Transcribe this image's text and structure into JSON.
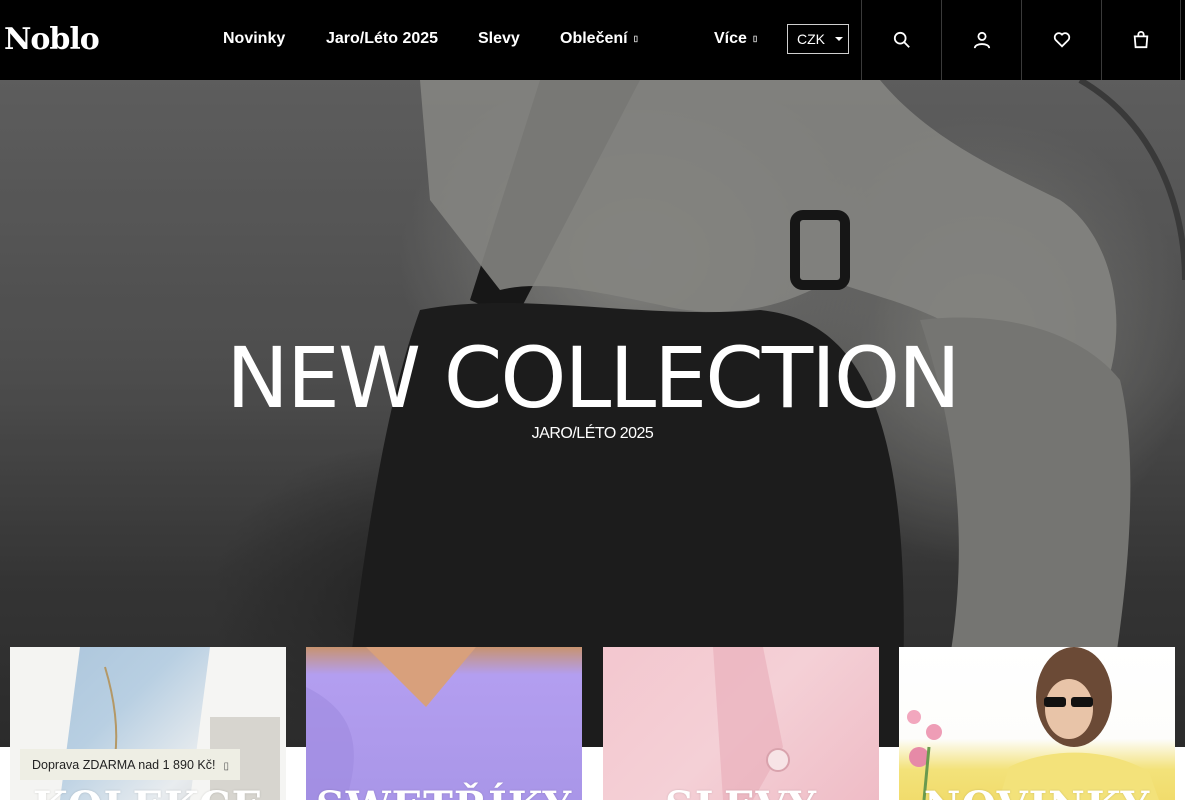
{
  "brand": {
    "logo_text": "Noblo"
  },
  "nav": {
    "items": [
      {
        "label": "Novinky"
      },
      {
        "label": "Jaro/Léto 2025"
      },
      {
        "label": "Slevy"
      },
      {
        "label": "Oblečení",
        "caret": "▯"
      },
      {
        "label": "Více",
        "caret": "▯"
      }
    ],
    "currency": "CZK"
  },
  "header_icons": [
    "search-icon",
    "user-icon",
    "heart-icon",
    "cart-icon"
  ],
  "hero": {
    "title": "NEW COLLECTION",
    "subtitle": "JARO/LÉTO 2025"
  },
  "tiles": [
    {
      "label": "KOLEKCE"
    },
    {
      "label": "SWETŘÍKY"
    },
    {
      "label": "SLEVY"
    },
    {
      "label": "NOVINKY"
    }
  ],
  "shipping_bar": {
    "text": "Doprava ZDARMA nad 1 890 Kč!",
    "close": "▯"
  },
  "colors": {
    "header_bg": "#000000",
    "tile_blue": "#a9c3da",
    "tile_purple": "#b39ef0",
    "tile_pink": "#f3c7cf",
    "tile_yellow": "#f3e27a",
    "shipping_bg": "#eeeee4"
  }
}
